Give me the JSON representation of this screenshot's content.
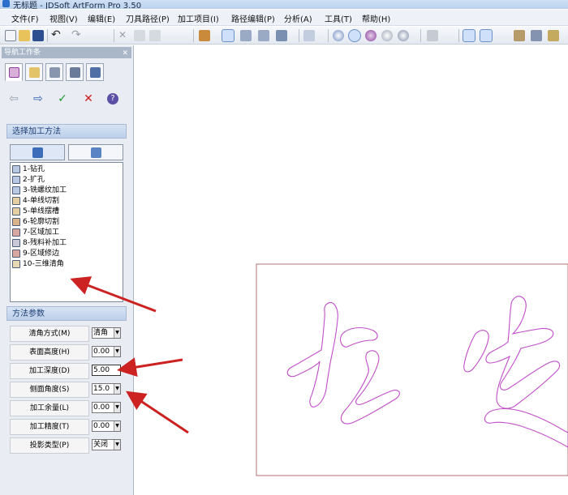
{
  "window": {
    "title": "无标题 - JDSoft ArtForm Pro 3.50"
  },
  "menu": [
    "文件(F)",
    "视图(V)",
    "编辑(E)",
    "刀具路径(P)",
    "加工项目(I)",
    "路径编辑(P)",
    "分析(A)",
    "工具(T)",
    "帮助(H)"
  ],
  "toolbar": {
    "buttons": [
      "new-icon",
      "open-icon",
      "save-icon",
      "undo-icon",
      "redo-icon",
      "cut-icon",
      "copy-icon",
      "paste-icon",
      "cube-view-icon",
      "iso-view-icon",
      "front-view-icon",
      "top-view-icon",
      "axis-icon",
      "select-icon",
      "shade-icon",
      "sphere-icon",
      "wire-icon",
      "eye-icon",
      "grid-icon",
      "snap-icon",
      "tool-icon",
      "layer-icon",
      "path-icon"
    ]
  },
  "panel": {
    "title": "导航工作条",
    "close": "✕",
    "nav": {
      "back": "⇦",
      "forward": "⇨",
      "ok": "✓",
      "cancel": "✕",
      "help": "?"
    },
    "method_section": "选择加工方法",
    "methods": [
      "1-钻孔",
      "2-扩孔",
      "3-铣螺纹加工",
      "4-单线切割",
      "5-单线摆槽",
      "6-轮廓切割",
      "7-区域加工",
      "8-残料补加工",
      "9-区域修边",
      "10-三维清角"
    ],
    "param_section": "方法参数",
    "params": [
      {
        "label": "清角方式(M)",
        "value": "清角"
      },
      {
        "label": "表面高度(H)",
        "value": "0.00"
      },
      {
        "label": "加工深度(D)",
        "value": "5.00"
      },
      {
        "label": "侧面角度(S)",
        "value": "15.0"
      },
      {
        "label": "加工余量(L)",
        "value": "0.00"
      },
      {
        "label": "加工精度(T)",
        "value": "0.00"
      },
      {
        "label": "投影类型(P)",
        "value": "关闭"
      }
    ]
  },
  "colors": {
    "curve": "#c04ec8",
    "rect": "#b07070",
    "arrow": "#cc2222",
    "accent": "#3d6db8"
  }
}
